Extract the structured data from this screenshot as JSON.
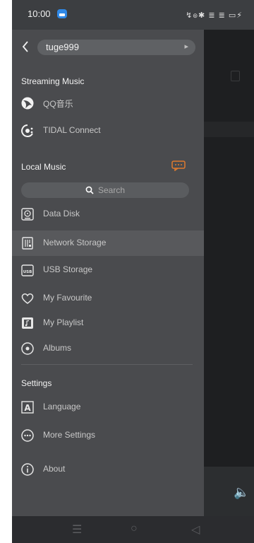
{
  "status_bar": {
    "time": "10:00",
    "icons_text": "↯๏✱ ≣ ≣ ▭⚡"
  },
  "user": {
    "name": "tuge999"
  },
  "sections": {
    "streaming": {
      "title": "Streaming Music",
      "items": [
        {
          "label": "QQ音乐",
          "icon": "qq-music-icon"
        },
        {
          "label": "TIDAL Connect",
          "icon": "tidal-icon"
        }
      ]
    },
    "local": {
      "title": "Local Music",
      "search_label": "Search",
      "items": [
        {
          "label": "Data Disk",
          "icon": "disk-icon"
        },
        {
          "label": "Network Storage",
          "icon": "network-storage-icon",
          "selected": true
        },
        {
          "label": "USB Storage",
          "icon": "usb-icon"
        },
        {
          "label": "My Favourite",
          "icon": "heart-icon"
        },
        {
          "label": "My Playlist",
          "icon": "playlist-icon"
        },
        {
          "label": "Albums",
          "icon": "album-icon"
        }
      ]
    },
    "settings": {
      "title": "Settings",
      "items": [
        {
          "label": "Language",
          "icon": "language-icon"
        },
        {
          "label": "More Settings",
          "icon": "more-settings-icon"
        },
        {
          "label": "About",
          "icon": "info-icon"
        }
      ]
    }
  },
  "colors": {
    "drawer_bg": "#4a4b4e",
    "accent": "#e07b2e",
    "selected_bg": "#58595c"
  }
}
